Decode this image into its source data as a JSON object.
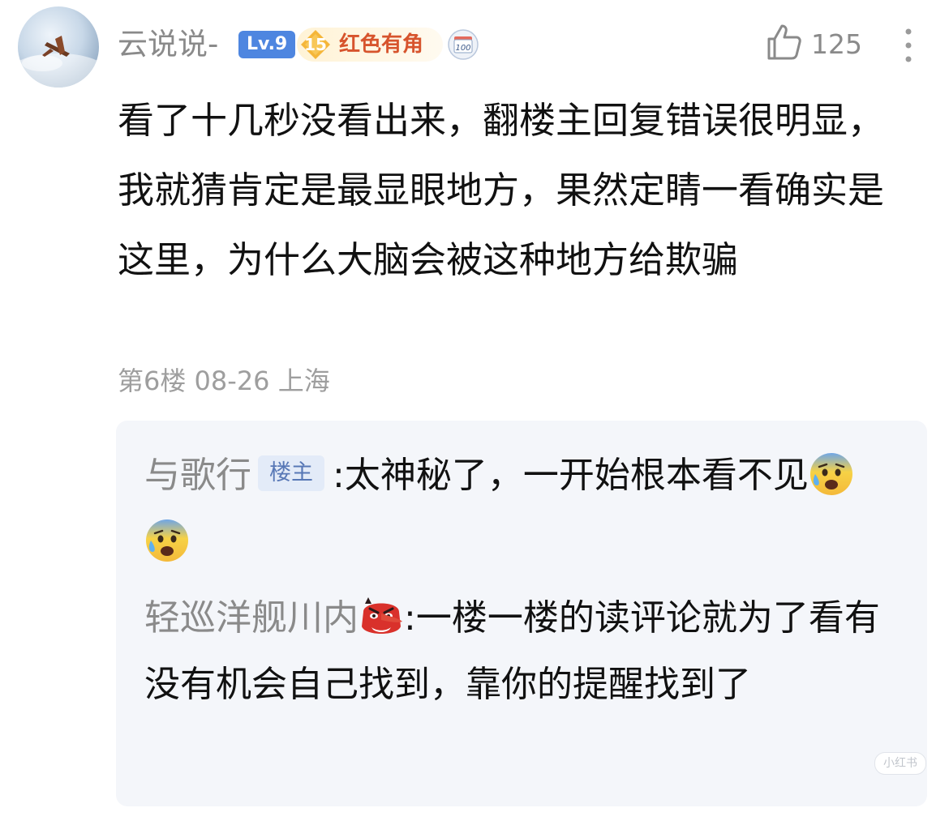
{
  "comment": {
    "username": "云说说-",
    "level_badge": "Lv.9",
    "fan_badge_number": "15",
    "fan_badge_label": "红色有角",
    "calendar_badge_number": "100",
    "like_count": "125",
    "text": "看了十几秒没看出来，翻楼主回复错误很明显，我就猜肯定是最显眼地方，果然定睛一看确实是这里，为什么大脑会被这种地方给欺骗",
    "floor": "第6楼",
    "date": "08-26",
    "location": "上海"
  },
  "replies": [
    {
      "username": "与歌行",
      "tag": "楼主",
      "separator": ":",
      "text": "太神秘了，一开始根本看不见",
      "emojis": [
        "anxious-sweat-face",
        "anxious-sweat-face"
      ]
    },
    {
      "username": "轻巡洋舰川内",
      "separator": ":",
      "text": "一楼一楼的读评论就为了看有没有机会自己找到，靠你的提醒找到了",
      "emojis": [
        "goblin-mask"
      ]
    }
  ],
  "watermark": "小红书",
  "colors": {
    "username_gray": "#8a8a8a",
    "level_blue": "#4e86e0",
    "fan_red": "#d7542d",
    "reply_bg": "#f4f6fa",
    "op_tag_text": "#5878b6"
  }
}
